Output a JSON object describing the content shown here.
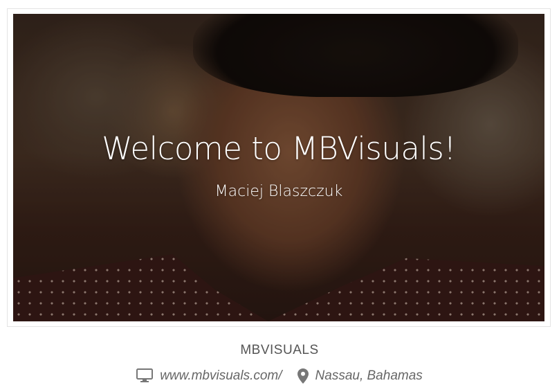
{
  "hero": {
    "title": "Welcome to MBVisuals!",
    "subtitle": "Maciej Blaszczuk",
    "image": "smiling-man-portrait"
  },
  "profile": {
    "name": "MBVISUALS",
    "website": "www.mbvisuals.com/",
    "location": "Nassau, Bahamas",
    "website_icon": "monitor-icon",
    "location_icon": "map-pin-icon"
  },
  "colors": {
    "text_muted": "#666666",
    "title_text": "#ffffff",
    "frame_border": "#e3e3e3"
  }
}
